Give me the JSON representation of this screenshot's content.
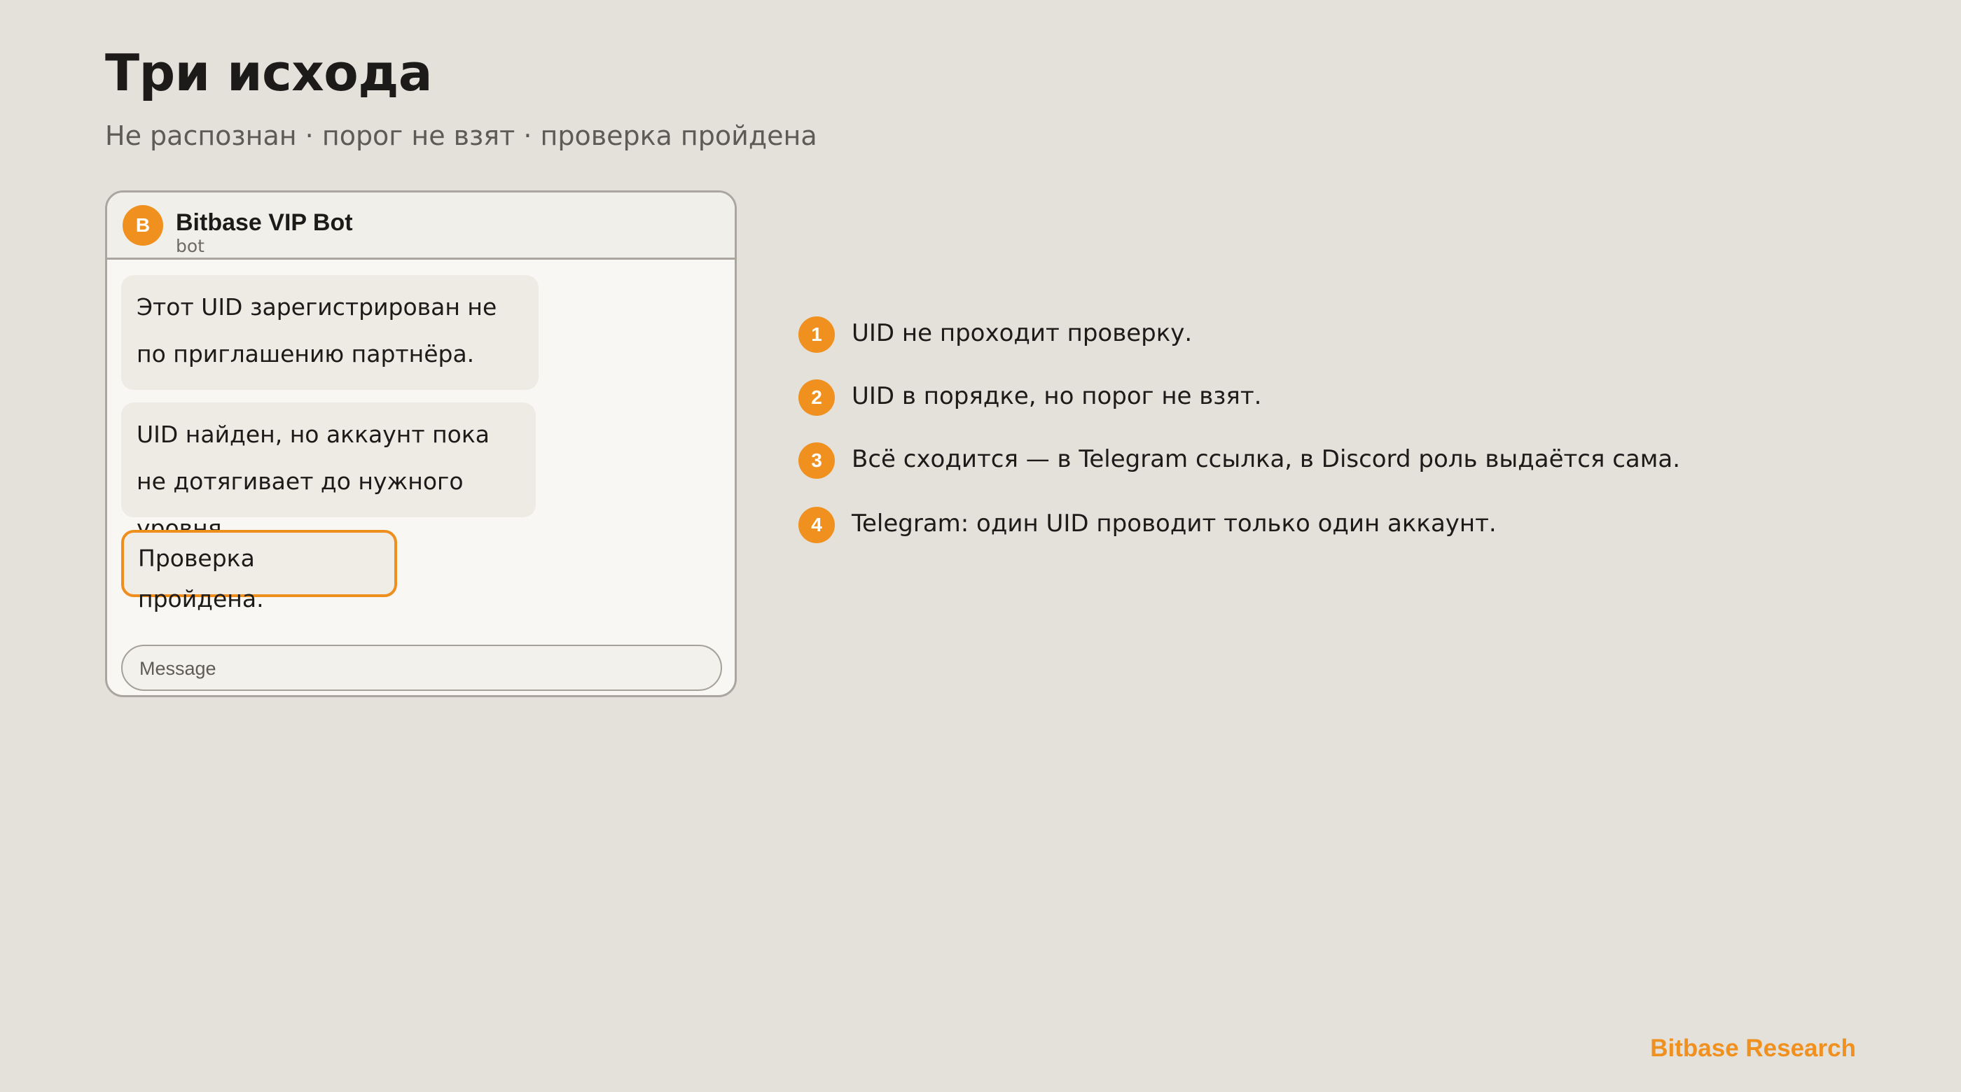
{
  "slide": {
    "title": "Три исхода",
    "subtitle": "Не распознан · порог не взят · проверка пройдена"
  },
  "chat": {
    "avatar_letter": "B",
    "bot_name": "Bitbase VIP Bot",
    "bot_status": "bot",
    "messages": [
      {
        "text": "Этот UID зарегистрирован не по приглашению партнёра."
      },
      {
        "text": "UID найден, но аккаунт пока не дотягивает до нужного уровня."
      },
      {
        "text": "Проверка пройдена."
      }
    ],
    "input_placeholder": "Message"
  },
  "outcomes": [
    {
      "number": "1",
      "text": "UID не проходит проверку."
    },
    {
      "number": "2",
      "text": "UID в порядке, но порог не взят."
    },
    {
      "number": "3",
      "text": "Всё сходится — в Telegram ссылка, в Discord роль выдаётся сама."
    },
    {
      "number": "4",
      "text": "Telegram: один UID проводит только один аккаунт."
    }
  ],
  "footer": {
    "brand": "Bitbase Research"
  },
  "colors": {
    "background": "#e4e0da",
    "accent": "#f0901e",
    "bubble": "#eeebe5",
    "text": "#1c1b19"
  }
}
